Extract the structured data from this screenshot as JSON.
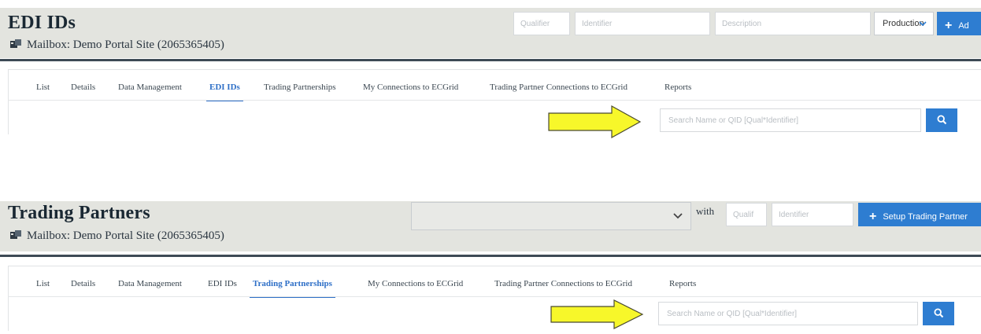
{
  "edi_ids_panel": {
    "title": "EDI IDs",
    "mailbox": "Mailbox: Demo Portal Site (2065365405)",
    "qualifier_placeholder": "Qualifier",
    "identifier_placeholder": "Identifier",
    "description_placeholder": "Description",
    "environment_select": "Production",
    "add_button": "Ad",
    "tabs": [
      "List",
      "Details",
      "Data Management",
      "EDI IDs",
      "Trading Partnerships",
      "My Connections to ECGrid",
      "Trading Partner Connections to ECGrid",
      "Reports"
    ],
    "active_tab": "EDI IDs",
    "search_placeholder": "Search Name or QID [Qual*Identifier]"
  },
  "trading_partners_panel": {
    "title": "Trading Partners",
    "mailbox": "Mailbox: Demo Portal Site (2065365405)",
    "with_label": "with",
    "qualifier_placeholder": "Qualif",
    "identifier_placeholder": "Identifier",
    "setup_button": "Setup Trading Partner",
    "tabs": [
      "List",
      "Details",
      "Data Management",
      "EDI IDs",
      "Trading Partnerships",
      "My Connections to ECGrid",
      "Trading Partner Connections to ECGrid",
      "Reports"
    ],
    "active_tab": "Trading Partnerships",
    "search_placeholder": "Search Name or QID [Qual*Identifier]"
  },
  "icons": [
    "mailbox-icon",
    "chevron-down-icon",
    "plus-icon",
    "search-icon",
    "annotation-arrow"
  ],
  "colors": {
    "accent": "#2e7dd1",
    "header_bg": "#e3e4df",
    "active_tab": "#2e6fc7",
    "arrow_fill": "#f7f72a"
  }
}
